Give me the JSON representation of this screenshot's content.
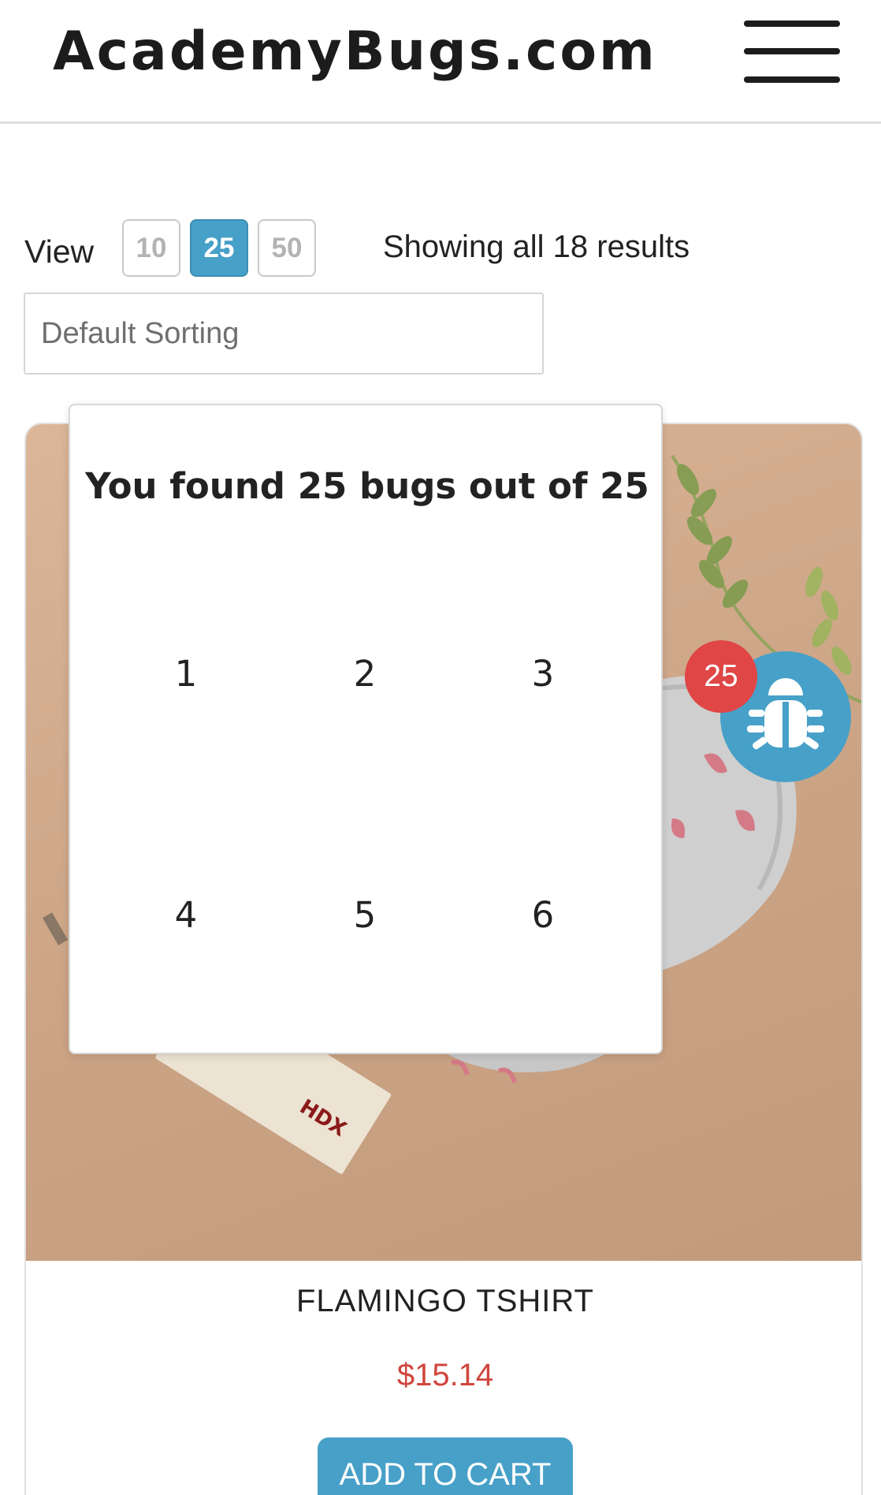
{
  "header": {
    "logo": "AcademyBugs.com",
    "menu_icon": "hamburger-menu-icon"
  },
  "toolbar": {
    "view_label": "View",
    "view_options": [
      {
        "label": "10",
        "active": false
      },
      {
        "label": "25",
        "active": true
      },
      {
        "label": "50",
        "active": false
      }
    ],
    "results_text": "Showing all 18 results",
    "sort_value": "Default Sorting"
  },
  "product": {
    "name": "FLAMINGO TSHIRT",
    "price": "$15.14",
    "add_to_cart": "ADD TO CART",
    "image_text": "HDX"
  },
  "bug_popup": {
    "title": "You found 25 bugs out of 25",
    "numbers": [
      "1",
      "2",
      "3",
      "4",
      "5",
      "6"
    ]
  },
  "bug_widget": {
    "count": "25",
    "icon": "bug-icon"
  },
  "colors": {
    "accent": "#47a0c8",
    "price": "#d0453d",
    "badge": "#e04646"
  }
}
